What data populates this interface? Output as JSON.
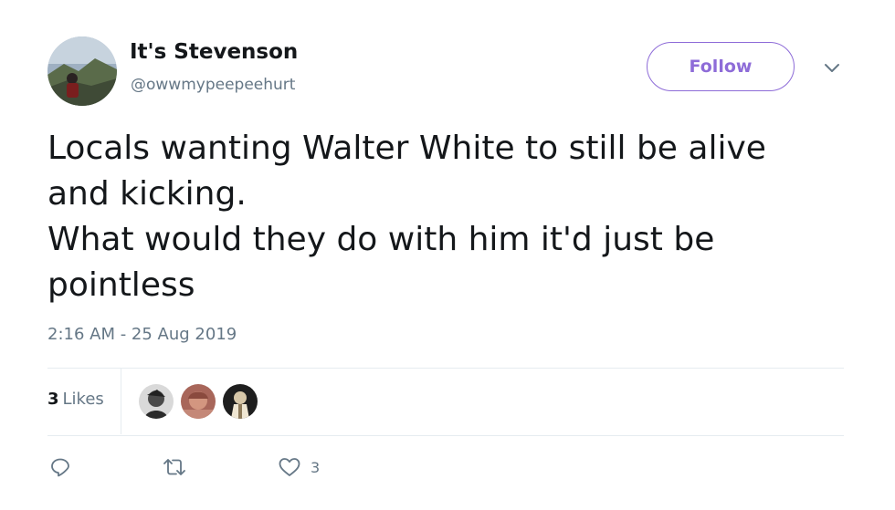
{
  "tweet": {
    "author": {
      "display_name": "It's Stevenson",
      "handle": "@owwmypeepeehurt"
    },
    "follow_label": "Follow",
    "text": "Locals wanting Walter White to still be alive\nand kicking.\nWhat would they do with him it'd just be\npointless",
    "timestamp": "2:16 AM - 25 Aug 2019",
    "likes": {
      "count": "3",
      "label": "Likes"
    },
    "actions": {
      "reply_icon": "reply-icon",
      "retweet_icon": "retweet-icon",
      "like_icon": "heart-icon",
      "like_count": "3"
    }
  },
  "colors": {
    "accent": "#8e6cd8",
    "text": "#14171a",
    "secondary": "#657786",
    "divider": "#e6ecf0"
  }
}
